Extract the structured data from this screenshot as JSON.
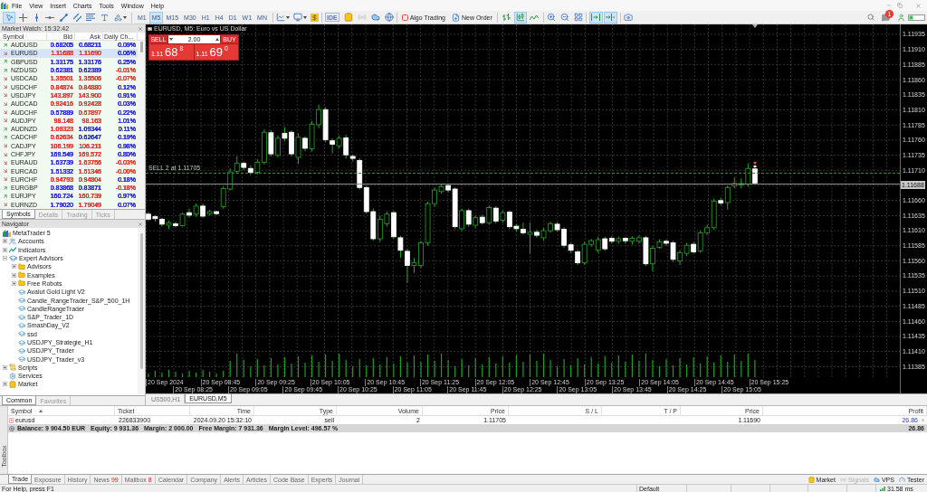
{
  "menu": [
    "File",
    "View",
    "Insert",
    "Charts",
    "Tools",
    "Window",
    "Help"
  ],
  "toolbar": {
    "drawing_tools": [
      {
        "kind": "cursor",
        "selected": true
      },
      {
        "kind": "crosshair",
        "selected": false
      },
      {
        "kind": "vertical_line",
        "selected": false
      },
      {
        "kind": "horizontal_line",
        "selected": false
      },
      {
        "kind": "trend_line",
        "selected": false
      },
      {
        "kind": "channel",
        "selected": false
      },
      {
        "kind": "fibonacci",
        "selected": false
      },
      {
        "kind": "text",
        "selected": false
      },
      {
        "kind": "shapes",
        "selected": false
      }
    ],
    "timeframes": [
      {
        "label": "M1",
        "selected": false
      },
      {
        "label": "M5",
        "selected": true
      },
      {
        "label": "M15",
        "selected": false
      },
      {
        "label": "M30",
        "selected": false
      },
      {
        "label": "H1",
        "selected": false
      },
      {
        "label": "H4",
        "selected": false
      },
      {
        "label": "D1",
        "selected": false
      },
      {
        "label": "W1",
        "selected": false
      },
      {
        "label": "MN",
        "selected": false
      }
    ],
    "ide_label": "IDE",
    "signals": {
      "disabled": true
    },
    "algo_trading": {
      "label": "Algo Trading",
      "on": false
    },
    "new_order": "New Order",
    "chart_types": [
      {
        "kind": "bars",
        "selected": false
      },
      {
        "kind": "candles",
        "selected": true
      },
      {
        "kind": "line",
        "selected": false
      }
    ],
    "autoscroll": {
      "on": true
    },
    "chart_shift": {
      "on": true
    },
    "notification_count": "1"
  },
  "market_watch": {
    "title": "Market Watch: 15:32:42",
    "columns": [
      "Symbol",
      "Bid",
      "Ask",
      "Daily Ch..."
    ],
    "rows": [
      {
        "symbol": "AUDUSD",
        "rising": true,
        "bid": {
          "text": "0.68205",
          "color": "#3434d8"
        },
        "ask": {
          "text": "0.68211",
          "color": "#3434d8"
        },
        "change": {
          "text": "0.09%",
          "color": "#3434d8"
        },
        "selected": false
      },
      {
        "symbol": "EURUSD",
        "rising": false,
        "bid": {
          "text": "1.11688",
          "color": "#e0413a"
        },
        "ask": {
          "text": "1.11690",
          "color": "#e0413a"
        },
        "change": {
          "text": "0.06%",
          "color": "#3434d8"
        },
        "selected": true
      },
      {
        "symbol": "GBPUSD",
        "rising": true,
        "bid": {
          "text": "1.33175",
          "color": "#3434d8"
        },
        "ask": {
          "text": "1.33176",
          "color": "#3434d8"
        },
        "change": {
          "text": "0.25%",
          "color": "#3434d8"
        },
        "selected": false
      },
      {
        "symbol": "NZDUSD",
        "rising": true,
        "bid": {
          "text": "0.62381",
          "color": "#3434d8"
        },
        "ask": {
          "text": "0.62389",
          "color": "#3434d8"
        },
        "change": {
          "text": "-0.01%",
          "color": "#e0413a"
        },
        "selected": false
      },
      {
        "symbol": "USDCAD",
        "rising": false,
        "bid": {
          "text": "1.35501",
          "color": "#e0413a"
        },
        "ask": {
          "text": "1.35506",
          "color": "#e0413a"
        },
        "change": {
          "text": "-0.07%",
          "color": "#e0413a"
        },
        "selected": false
      },
      {
        "symbol": "USDCHF",
        "rising": false,
        "bid": {
          "text": "0.84874",
          "color": "#e0413a"
        },
        "ask": {
          "text": "0.84880",
          "color": "#e0413a"
        },
        "change": {
          "text": "0.12%",
          "color": "#3434d8"
        },
        "selected": false
      },
      {
        "symbol": "USDJPY",
        "rising": false,
        "bid": {
          "text": "143.897",
          "color": "#e0413a"
        },
        "ask": {
          "text": "143.900",
          "color": "#e0413a"
        },
        "change": {
          "text": "0.91%",
          "color": "#3434d8"
        },
        "selected": false
      },
      {
        "symbol": "AUDCAD",
        "rising": false,
        "bid": {
          "text": "0.92416",
          "color": "#e0413a"
        },
        "ask": {
          "text": "0.92428",
          "color": "#e0413a"
        },
        "change": {
          "text": "0.03%",
          "color": "#3434d8"
        },
        "selected": false
      },
      {
        "symbol": "AUDCHF",
        "rising": false,
        "bid": {
          "text": "0.57889",
          "color": "#3434d8"
        },
        "ask": {
          "text": "0.57897",
          "color": "#e0413a"
        },
        "change": {
          "text": "0.22%",
          "color": "#3434d8"
        },
        "selected": false
      },
      {
        "symbol": "AUDJPY",
        "rising": false,
        "bid": {
          "text": "98.148",
          "color": "#e0413a"
        },
        "ask": {
          "text": "98.163",
          "color": "#e0413a"
        },
        "change": {
          "text": "1.01%",
          "color": "#3434d8"
        },
        "selected": false
      },
      {
        "symbol": "AUDNZD",
        "rising": true,
        "bid": {
          "text": "1.09323",
          "color": "#e0413a"
        },
        "ask": {
          "text": "1.09344",
          "color": "#3434d8"
        },
        "change": {
          "text": "0.11%",
          "color": "#3434d8"
        },
        "selected": false
      },
      {
        "symbol": "CADCHF",
        "rising": true,
        "bid": {
          "text": "0.62634",
          "color": "#e0413a"
        },
        "ask": {
          "text": "0.62647",
          "color": "#3434d8"
        },
        "change": {
          "text": "0.19%",
          "color": "#3434d8"
        },
        "selected": false
      },
      {
        "symbol": "CADJPY",
        "rising": false,
        "bid": {
          "text": "106.199",
          "color": "#e0413a"
        },
        "ask": {
          "text": "106.211",
          "color": "#e0413a"
        },
        "change": {
          "text": "0.98%",
          "color": "#3434d8"
        },
        "selected": false
      },
      {
        "symbol": "CHFJPY",
        "rising": false,
        "bid": {
          "text": "169.549",
          "color": "#3434d8"
        },
        "ask": {
          "text": "169.572",
          "color": "#e0413a"
        },
        "change": {
          "text": "0.80%",
          "color": "#3434d8"
        },
        "selected": false
      },
      {
        "symbol": "EURAUD",
        "rising": false,
        "bid": {
          "text": "1.63739",
          "color": "#3434d8"
        },
        "ask": {
          "text": "1.63756",
          "color": "#e0413a"
        },
        "change": {
          "text": "-0.03%",
          "color": "#e0413a"
        },
        "selected": false
      },
      {
        "symbol": "EURCAD",
        "rising": false,
        "bid": {
          "text": "1.51332",
          "color": "#3434d8"
        },
        "ask": {
          "text": "1.51346",
          "color": "#e0413a"
        },
        "change": {
          "text": "-0.00%",
          "color": "#e0413a"
        },
        "selected": false
      },
      {
        "symbol": "EURCHF",
        "rising": false,
        "bid": {
          "text": "0.94793",
          "color": "#e0413a"
        },
        "ask": {
          "text": "0.94804",
          "color": "#e0413a"
        },
        "change": {
          "text": "0.18%",
          "color": "#3434d8"
        },
        "selected": false
      },
      {
        "symbol": "EURGBP",
        "rising": true,
        "bid": {
          "text": "0.83868",
          "color": "#3434d8"
        },
        "ask": {
          "text": "0.83871",
          "color": "#3434d8"
        },
        "change": {
          "text": "-0.18%",
          "color": "#e0413a"
        },
        "selected": false
      },
      {
        "symbol": "EURJPY",
        "rising": true,
        "bid": {
          "text": "160.724",
          "color": "#3434d8"
        },
        "ask": {
          "text": "160.739",
          "color": "#e0413a"
        },
        "change": {
          "text": "0.97%",
          "color": "#3434d8"
        },
        "selected": false
      },
      {
        "symbol": "EURNZD",
        "rising": false,
        "bid": {
          "text": "1.79020",
          "color": "#3434d8"
        },
        "ask": {
          "text": "1.79049",
          "color": "#e0413a"
        },
        "change": {
          "text": "0.07%",
          "color": "#3434d8"
        },
        "selected": false
      }
    ],
    "tabs": [
      {
        "label": "Symbols",
        "selected": true
      },
      {
        "label": "Details",
        "selected": false
      },
      {
        "label": "Trading",
        "selected": false
      },
      {
        "label": "Ticks",
        "selected": false
      }
    ]
  },
  "navigator": {
    "title": "Navigator",
    "tree": {
      "label": "MetaTrader 5",
      "kind": "terminal",
      "children": [
        {
          "label": "Accounts",
          "kind": "accounts",
          "expanded": false
        },
        {
          "label": "Indicators",
          "kind": "indicators",
          "expanded": false
        },
        {
          "label": "Expert Advisors",
          "kind": "experts",
          "expanded": true,
          "children": [
            {
              "label": "Advisors",
              "kind": "folder",
              "expanded": false
            },
            {
              "label": "Examples",
              "kind": "folder",
              "expanded": false
            },
            {
              "label": "Free Robots",
              "kind": "folder",
              "expanded": false
            },
            {
              "label": "Avalut Gold Light V2",
              "kind": "expert"
            },
            {
              "label": "Candle_RangeTrader_S&P_500_1H",
              "kind": "expert"
            },
            {
              "label": "CandleRangeTrader",
              "kind": "expert"
            },
            {
              "label": "S&P_Trader_1D",
              "kind": "expert"
            },
            {
              "label": "SmashDay_V2",
              "kind": "expert"
            },
            {
              "label": "ssd",
              "kind": "expert"
            },
            {
              "label": "USDJPY_Strategie_H1",
              "kind": "expert"
            },
            {
              "label": "USDJPY_Trader",
              "kind": "expert"
            },
            {
              "label": "USDJPY_Trader_v3",
              "kind": "expert"
            }
          ]
        },
        {
          "label": "Scripts",
          "kind": "scripts",
          "expanded": false
        },
        {
          "label": "Services",
          "kind": "services"
        },
        {
          "label": "Market",
          "kind": "market",
          "expanded": false
        }
      ]
    },
    "tabs": [
      {
        "label": "Common",
        "selected": true
      },
      {
        "label": "Favorites",
        "selected": false
      }
    ]
  },
  "chart": {
    "title": "EURUSD, M5: Euro vs US Dollar",
    "trade_panel": {
      "sell_label": "SELL",
      "volume": "2.00",
      "buy_label": "BUY",
      "sell_price": {
        "prefix": "1.11",
        "pips": "68",
        "point": "8"
      },
      "buy_price": {
        "prefix": "1.11",
        "pips": "69",
        "point": "0"
      }
    },
    "order_label": "SELL 2 at 1.11705",
    "price_labels": [
      {
        "text": "1.11935",
        "kind": "tick"
      },
      {
        "text": "1.11910",
        "kind": "tick"
      },
      {
        "text": "1.11885",
        "kind": "tick"
      },
      {
        "text": "1.11860",
        "kind": "tick"
      },
      {
        "text": "1.11835",
        "kind": "tick"
      },
      {
        "text": "1.11810",
        "kind": "tick"
      },
      {
        "text": "1.11785",
        "kind": "tick"
      },
      {
        "text": "1.11760",
        "kind": "tick"
      },
      {
        "text": "1.11735",
        "kind": "tick"
      },
      {
        "text": "1.11710",
        "kind": "tick"
      },
      {
        "text": "1.11688",
        "kind": "bid"
      },
      {
        "text": "1.11660",
        "kind": "tick"
      },
      {
        "text": "1.11635",
        "kind": "tick"
      },
      {
        "text": "1.11610",
        "kind": "tick"
      },
      {
        "text": "1.11585",
        "kind": "tick"
      },
      {
        "text": "1.11560",
        "kind": "tick"
      },
      {
        "text": "1.11535",
        "kind": "tick"
      },
      {
        "text": "1.11510",
        "kind": "tick"
      },
      {
        "text": "1.11485",
        "kind": "tick"
      },
      {
        "text": "1.11460",
        "kind": "tick"
      },
      {
        "text": "1.11435",
        "kind": "tick"
      },
      {
        "text": "1.11410",
        "kind": "tick"
      },
      {
        "text": "1.11385",
        "kind": "tick"
      }
    ],
    "time_labels": [
      "20 Sep 2024",
      "20 Sep 08:25",
      "20 Sep 08:45",
      "20 Sep 09:05",
      "20 Sep 09:25",
      "20 Sep 09:45",
      "20 Sep 10:05",
      "20 Sep 10:25",
      "20 Sep 10:45",
      "20 Sep 11:05",
      "20 Sep 11:25",
      "20 Sep 11:45",
      "20 Sep 12:05",
      "20 Sep 12:25",
      "20 Sep 12:45",
      "20 Sep 13:05",
      "20 Sep 13:25",
      "20 Sep 13:45",
      "20 Sep 14:05",
      "20 Sep 14:25",
      "20 Sep 14:45",
      "20 Sep 15:05",
      "20 Sep 15:25"
    ]
  },
  "chart_tabs": [
    {
      "label": "US500,H1",
      "selected": false
    },
    {
      "label": "EURUSD,M5",
      "selected": true
    }
  ],
  "toolbox": {
    "title": "Toolbox",
    "columns": [
      {
        "label": "Symbol",
        "sorted": true
      },
      {
        "label": "Ticket",
        "sorted": false
      },
      {
        "label": "Time",
        "sorted": false
      },
      {
        "label": "Type",
        "sorted": false
      },
      {
        "label": "Volume",
        "sorted": false
      },
      {
        "label": "Price",
        "sorted": false
      },
      {
        "label": "S / L",
        "sorted": false
      },
      {
        "label": "T / P",
        "sorted": false
      },
      {
        "label": "Price",
        "sorted": false
      },
      {
        "label": "Profit",
        "sorted": false
      }
    ],
    "positions": [
      {
        "symbol": "eurusd",
        "ticket": "226833900",
        "time": "2024.09.20 15:32:10",
        "type": "sell",
        "volume": "2",
        "open_price": "1.11705",
        "current_price": "1.11690",
        "profit": "26.86"
      }
    ],
    "summary": {
      "items": [
        "Balance: 9 904.50 EUR",
        "Equity: 9 931.36",
        "Margin: 2 000.00",
        "Free Margin: 7 931.36",
        "Margin Level: 496.57 %"
      ],
      "profit": "26.86"
    },
    "tabs": [
      {
        "label": "Trade",
        "selected": true
      },
      {
        "label": "Exposure",
        "selected": false
      },
      {
        "label": "History",
        "selected": false
      },
      {
        "label": "News",
        "badge": "99",
        "selected": false
      },
      {
        "label": "Mailbox",
        "badge": "8",
        "selected": false
      },
      {
        "label": "Calendar",
        "selected": false
      },
      {
        "label": "Company",
        "selected": false
      },
      {
        "label": "Alerts",
        "selected": false
      },
      {
        "label": "Articles",
        "selected": false
      },
      {
        "label": "Code Base",
        "selected": false
      },
      {
        "label": "Experts",
        "selected": false
      },
      {
        "label": "Journal",
        "selected": false
      }
    ],
    "side_tabs": [
      {
        "label": "Market",
        "kind": "market",
        "disabled": false
      },
      {
        "label": "Signals",
        "kind": "signals",
        "disabled": true
      },
      {
        "label": "VPS",
        "kind": "vps",
        "disabled": false
      },
      {
        "label": "Tester",
        "kind": "tester",
        "disabled": false
      }
    ]
  },
  "status_bar": {
    "help": "For Help, press F1",
    "profile": "Default",
    "ping": "31.58 ms"
  }
}
